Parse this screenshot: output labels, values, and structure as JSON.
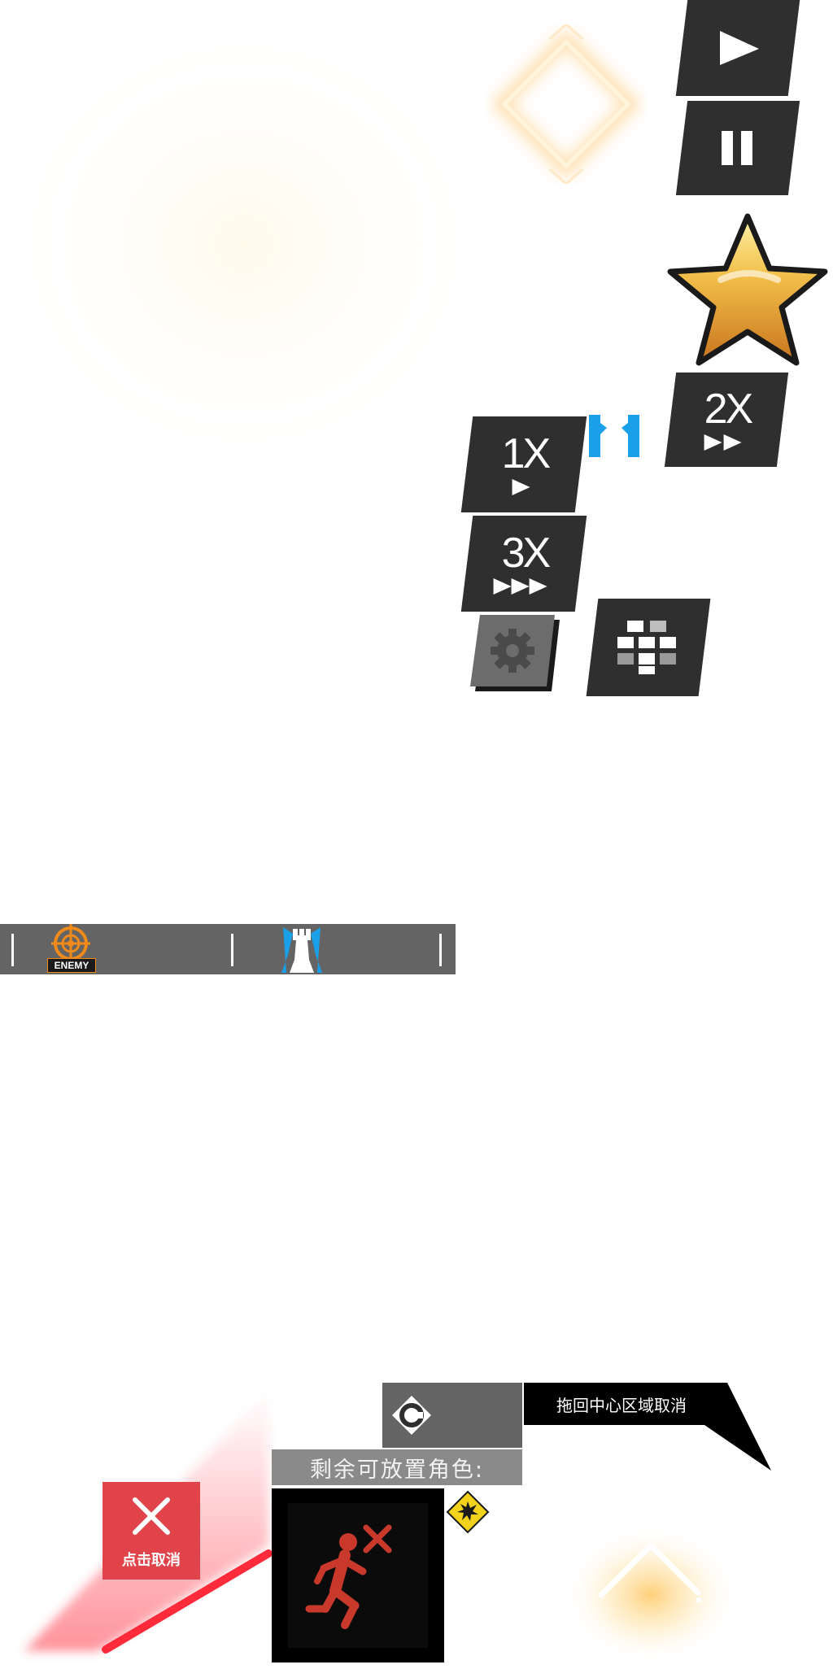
{
  "hud": {
    "play_icon": "play-icon",
    "pause_icon": "pause-icon",
    "star_icon": "star-icon",
    "speed_1x_label": "1X",
    "speed_2x_label": "2X",
    "speed_3x_label": "3X",
    "settings_icon": "gear-icon",
    "grid_icon": "grid-icon"
  },
  "tab_bar": {
    "enemy_icon": "enemy-target-icon",
    "enemy_label": "ENEMY",
    "tower_icon": "rook-tower-icon"
  },
  "deploy": {
    "cancel_label": "点击取消",
    "drag_cancel_hint": "拖回中心区域取消",
    "remaining_label": "剩余可放置角色:",
    "character_icon": "running-man-icon",
    "warning_icon": "explosion-warning-icon",
    "class_icon": "c-badge-icon"
  },
  "colors": {
    "button_dark": "#2f2f2f",
    "bar_gray": "#646464",
    "accent_orange": "#f08a1a",
    "accent_blue": "#1aa0e8",
    "cancel_red": "#e0434a",
    "runner_red": "#c8392b",
    "star_gold": "#e9a62a"
  }
}
